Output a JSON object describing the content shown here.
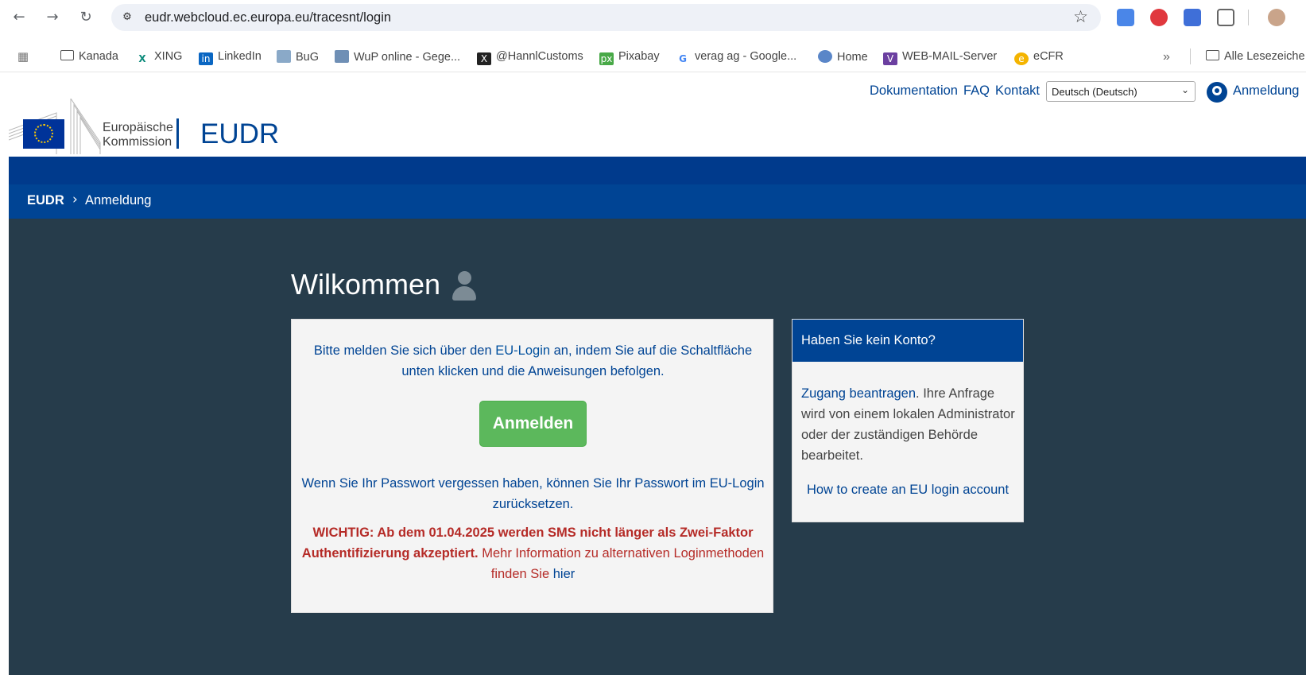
{
  "browser": {
    "url": "eudr.webcloud.ec.europa.eu/tracesnt/login",
    "bookmarks": [
      {
        "label": "Kanada",
        "icon": "folder-icon"
      },
      {
        "label": "XING",
        "icon": "xing-icon"
      },
      {
        "label": "LinkedIn",
        "icon": "linkedin-icon"
      },
      {
        "label": "BuG",
        "icon": "bug-icon"
      },
      {
        "label": "WuP online - Gege...",
        "icon": "wup-icon"
      },
      {
        "label": "@HannlCustoms",
        "icon": "x-icon"
      },
      {
        "label": "Pixabay",
        "icon": "pixabay-icon"
      },
      {
        "label": "verag ag - Google...",
        "icon": "google-icon"
      },
      {
        "label": "Home",
        "icon": "home-icon"
      },
      {
        "label": "WEB-MAIL-Server",
        "icon": "webmail-icon"
      },
      {
        "label": "eCFR",
        "icon": "ecfr-icon"
      }
    ],
    "more_bookmarks": "»",
    "all_bookmarks": "Alle Lesezeiche"
  },
  "header": {
    "links": {
      "documentation": "Dokumentation",
      "faq": "FAQ",
      "contact": "Kontakt"
    },
    "language": "Deutsch (Deutsch)",
    "login_link": "Anmeldung",
    "org_line1": "Europäische",
    "org_line2": "Kommission",
    "site_name": "EUDR"
  },
  "breadcrumb": {
    "root": "EUDR",
    "current": "Anmeldung"
  },
  "main": {
    "title": "Wilkommen",
    "intro_1": "Bitte melden Sie sich über den ",
    "intro_link": "EU-Login",
    "intro_2": " an, indem Sie auf die Schaltfläche unten klicken und die Anweisungen befolgen.",
    "login_button": "Anmelden",
    "forgot_1": "Wenn Sie Ihr Passwort vergessen haben, können Sie ",
    "forgot_link": "Ihr Passwort",
    "forgot_2": " im EU-Login zurücksetzen.",
    "important_bold": "WICHTIG: Ab dem 01.04.2025 werden SMS nicht länger als Zwei-Faktor Authentifizierung akzeptiert.",
    "important_text": " Mehr Information zu alternativen Loginmethoden finden Sie ",
    "important_link": "hier"
  },
  "side": {
    "title": "Haben Sie kein Konto?",
    "request_link": "Zugang beantragen",
    "request_text": ". Ihre Anfrage wird von einem lokalen Administrator oder der zuständigen Behörde bearbeitet.",
    "howto_link": "How to create an EU login account"
  },
  "colors": {
    "brand": "#004494",
    "main_bg": "#263c4b",
    "button": "#5cb85c",
    "warning": "#b52b27"
  }
}
